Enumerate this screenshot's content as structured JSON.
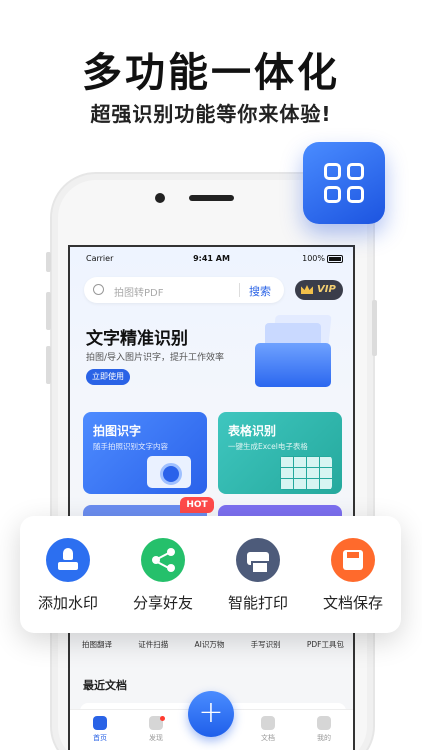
{
  "promo": {
    "headline": "多功能一体化",
    "subline": "超强识别功能等你来体验!"
  },
  "status_bar": {
    "carrier": "Carrier",
    "time": "9:41 AM",
    "battery": "100%"
  },
  "search": {
    "placeholder": "拍图转PDF",
    "button_label": "搜索"
  },
  "vip": {
    "label": "VIP"
  },
  "banner": {
    "title": "文字精准识别",
    "subtitle": "拍图/导入图片识字，提升工作效率",
    "button_label": "立即使用"
  },
  "tool_cards": [
    {
      "title": "拍图识字",
      "desc": "随手拍照识别文字内容"
    },
    {
      "title": "表格识别",
      "desc": "一键生成Excel电子表格"
    }
  ],
  "hot_badge": "HOT",
  "small_tools": [
    "拍图翻译",
    "证件扫描",
    "AI识万物",
    "手写识别",
    "PDF工具包"
  ],
  "recent": {
    "title": "最近文档"
  },
  "tabs": [
    {
      "label": "首页"
    },
    {
      "label": "发现"
    },
    {
      "label": "文档"
    },
    {
      "label": "我的"
    }
  ],
  "fab_label": "+",
  "popup": {
    "items": [
      {
        "label": "添加水印",
        "icon": "stamp-icon",
        "color": "#2c6ff0"
      },
      {
        "label": "分享好友",
        "icon": "share-icon",
        "color": "#25c06b"
      },
      {
        "label": "智能打印",
        "icon": "printer-icon",
        "color": "#4d5b7a"
      },
      {
        "label": "文档保存",
        "icon": "save-icon",
        "color": "#ff6a2c"
      }
    ]
  },
  "colors": {
    "accent": "#2a63e6",
    "hot": "#ff4a4a"
  }
}
